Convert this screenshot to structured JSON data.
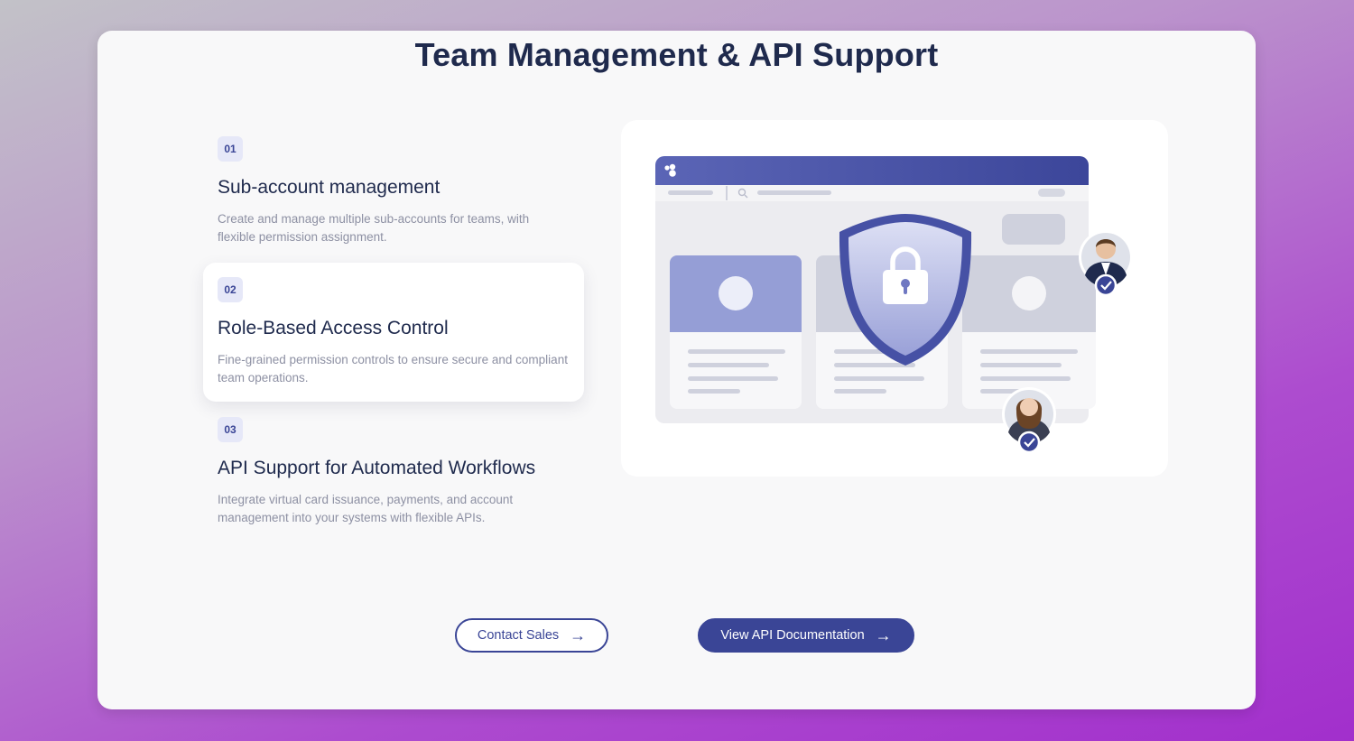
{
  "page": {
    "title": "Team Management & API Support"
  },
  "features": [
    {
      "number": "01",
      "title": "Sub-account management",
      "description": "Create and manage multiple sub-accounts for teams, with flexible permission assignment."
    },
    {
      "number": "02",
      "title": "Role-Based Access Control",
      "description": "Fine-grained permission controls to ensure secure and compliant team operations."
    },
    {
      "number": "03",
      "title": "API Support for Automated Workflows",
      "description": "Integrate virtual card issuance, payments, and account management into your systems with flexible APIs."
    }
  ],
  "illustration": {
    "icons": [
      "app-logo-icon",
      "search-icon",
      "shield-lock-icon",
      "user-avatar",
      "check-icon"
    ]
  },
  "buttons": {
    "contact_sales": "Contact Sales",
    "view_api_docs": "View API Documentation",
    "arrow_icon": "→"
  },
  "colors": {
    "accent": "#3a4596",
    "title": "#1f2a4d",
    "muted": "#8d90a3"
  }
}
